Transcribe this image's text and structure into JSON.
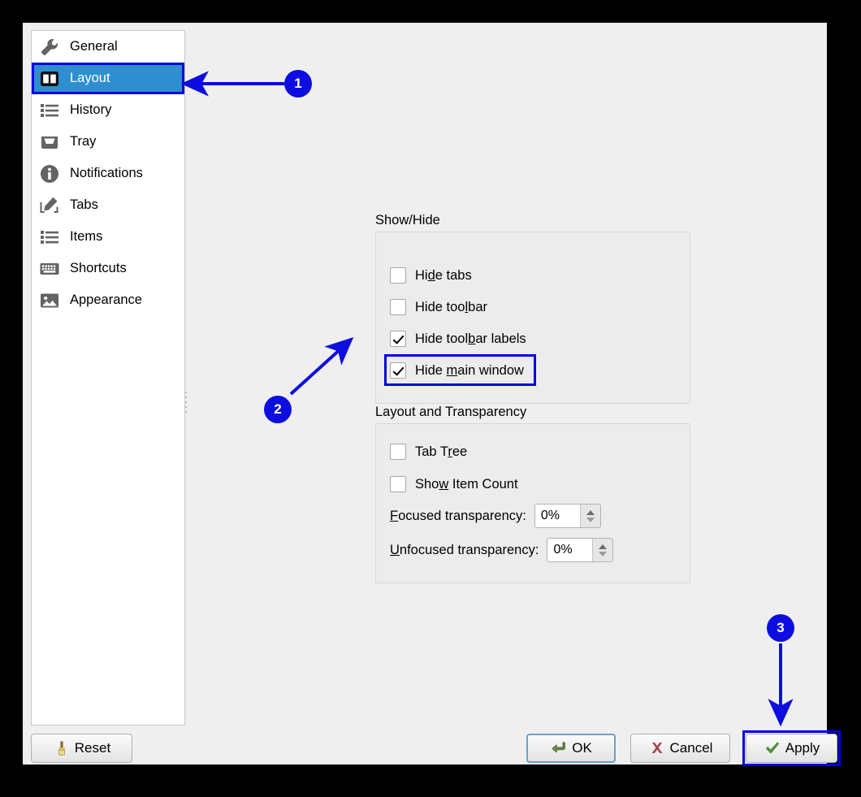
{
  "window": {
    "background_color": "#efefef",
    "highlight_color": "#0000e0",
    "accent_color": "#2f8ed0"
  },
  "sidebar": {
    "items": [
      {
        "label": "General",
        "icon": "wrench-icon",
        "selected": false
      },
      {
        "label": "Layout",
        "icon": "layout-columns-icon",
        "selected": true
      },
      {
        "label": "History",
        "icon": "list-icon",
        "selected": false
      },
      {
        "label": "Tray",
        "icon": "tray-icon",
        "selected": false
      },
      {
        "label": "Notifications",
        "icon": "info-circle-icon",
        "selected": false
      },
      {
        "label": "Tabs",
        "icon": "pencil-edit-icon",
        "selected": false
      },
      {
        "label": "Items",
        "icon": "list-icon",
        "selected": false
      },
      {
        "label": "Shortcuts",
        "icon": "keyboard-icon",
        "selected": false
      },
      {
        "label": "Appearance",
        "icon": "image-icon",
        "selected": false
      }
    ]
  },
  "main": {
    "show_hide": {
      "title": "Show/Hide",
      "checkboxes": [
        {
          "label_pre": "Hi",
          "mnemonic": "d",
          "label_post": "e tabs",
          "checked": false,
          "highlighted": false
        },
        {
          "label_pre": "Hide too",
          "mnemonic": "l",
          "label_post": "bar",
          "checked": false,
          "highlighted": false
        },
        {
          "label_pre": "Hide tool",
          "mnemonic": "b",
          "label_post": "ar labels",
          "checked": true,
          "highlighted": false
        },
        {
          "label_pre": "Hide ",
          "mnemonic": "m",
          "label_post": "ain window",
          "checked": true,
          "highlighted": true
        }
      ]
    },
    "layout_transparency": {
      "title": "Layout and Transparency",
      "checkboxes": [
        {
          "label_pre": "Tab T",
          "mnemonic": "r",
          "label_post": "ee",
          "checked": false,
          "highlighted": false
        },
        {
          "label_pre": "Sho",
          "mnemonic": "w",
          "label_post": " Item Count",
          "checked": false,
          "highlighted": false
        }
      ],
      "spinners": [
        {
          "label_pre": "",
          "mnemonic": "F",
          "label_post": "ocused transparency:",
          "value": "0%"
        },
        {
          "label_pre": "",
          "mnemonic": "U",
          "label_post": "nfocused transparency:",
          "value": "0%"
        }
      ]
    }
  },
  "buttons": {
    "reset": {
      "label": "Reset",
      "icon": "brush-icon",
      "default": false,
      "highlighted": false
    },
    "ok": {
      "label": "OK",
      "icon": "enter-arrow-icon",
      "default": true,
      "highlighted": false
    },
    "cancel": {
      "label": "Cancel",
      "icon": "x-cross-icon",
      "default": false,
      "highlighted": false
    },
    "apply": {
      "label": "Apply",
      "icon": "check-icon",
      "default": false,
      "highlighted": true
    }
  },
  "annotations": {
    "badges": [
      {
        "number": "1",
        "target": "sidebar-item-layout"
      },
      {
        "number": "2",
        "target": "checkbox-hide-main-window"
      },
      {
        "number": "3",
        "target": "apply-button"
      }
    ]
  }
}
